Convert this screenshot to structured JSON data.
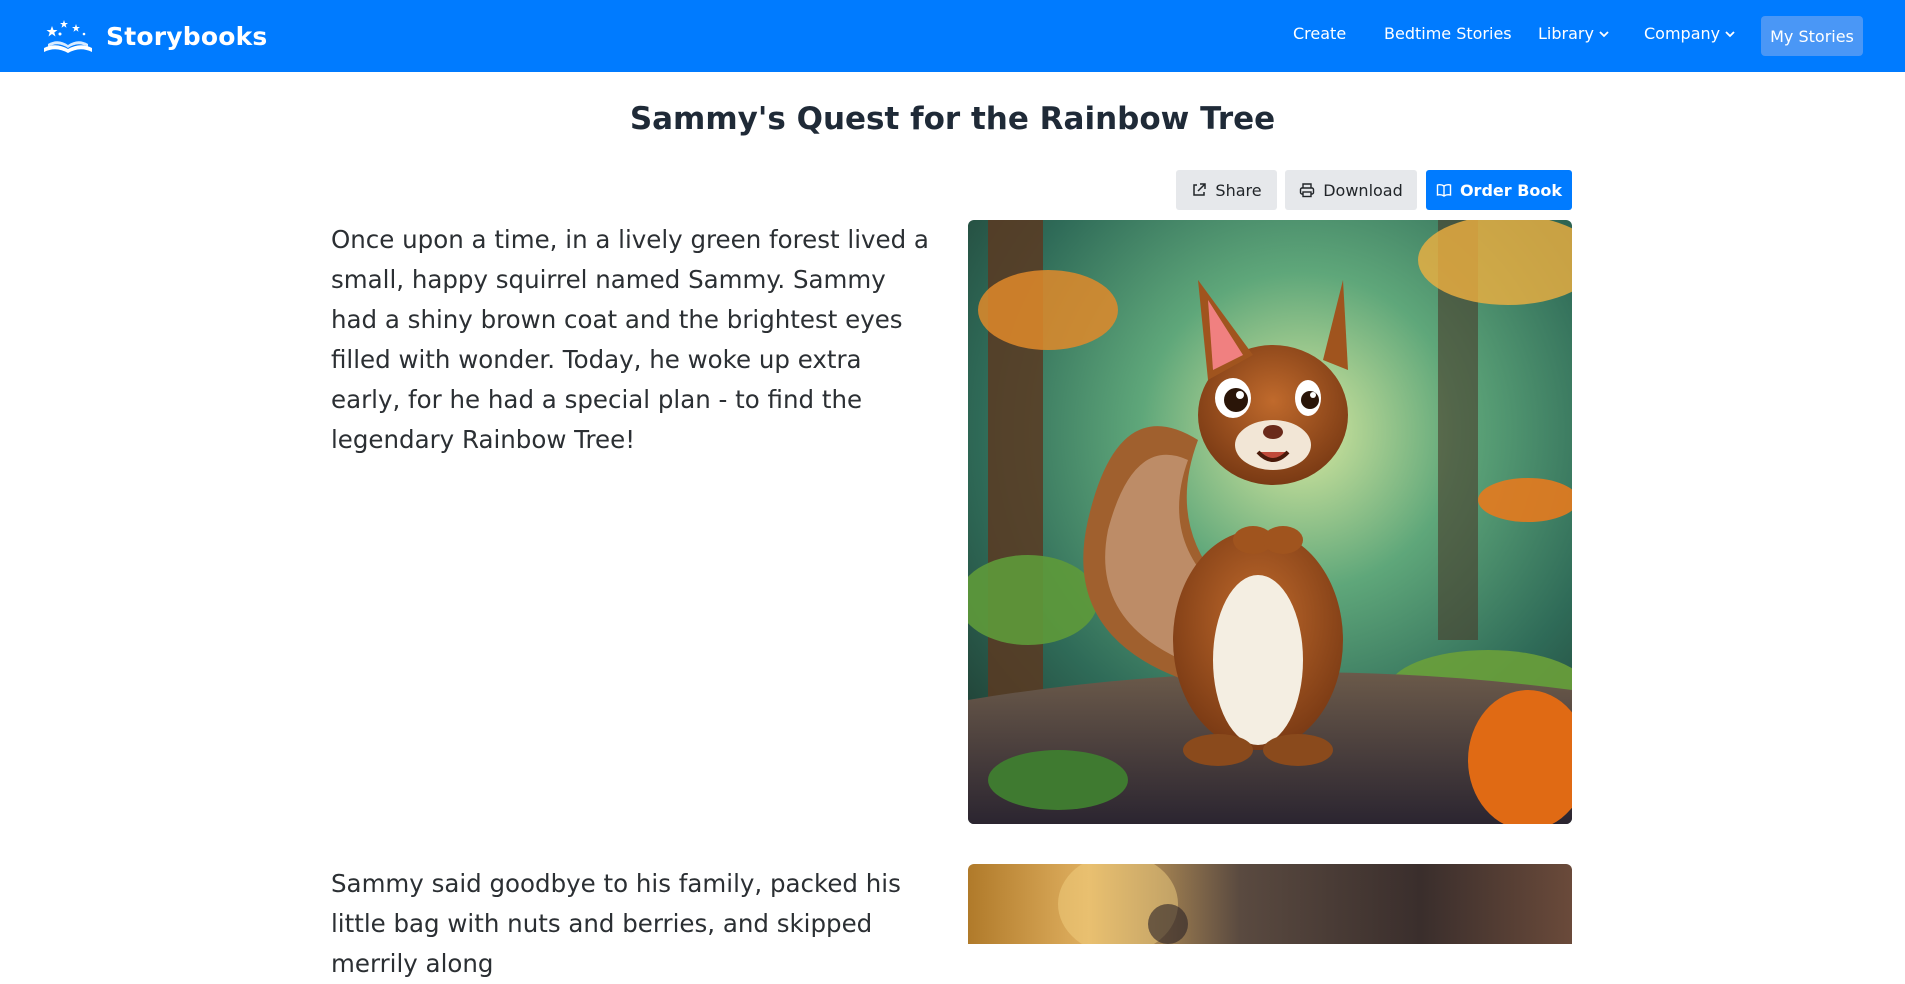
{
  "navbar": {
    "brand": "Storybooks",
    "links": {
      "create": "Create",
      "bedtime": "Bedtime Stories",
      "library": "Library",
      "company": "Company",
      "my_stories": "My Stories"
    }
  },
  "story": {
    "title": "Sammy's Quest for the Rainbow Tree",
    "actions": {
      "share": "Share",
      "download": "Download",
      "order": "Order Book"
    },
    "pages": [
      {
        "text": "Once upon a time, in a lively green forest lived a small, happy squirrel named Sammy. Sammy had a shiny brown coat and the brightest eyes filled with wonder. Today, he woke up extra early, for he had a special plan - to find the legendary Rainbow Tree!"
      },
      {
        "text": "Sammy said goodbye to his family, packed his little bag with nuts and berries, and skipped merrily along"
      }
    ]
  },
  "colors": {
    "primary": "#007bff",
    "my_stories_bg": "#4a97f6",
    "light_button": "#e6e8eb"
  },
  "icons": {
    "logo": "book-stars-logo",
    "share": "external-link-icon",
    "download": "printer-icon",
    "order": "open-book-icon"
  }
}
